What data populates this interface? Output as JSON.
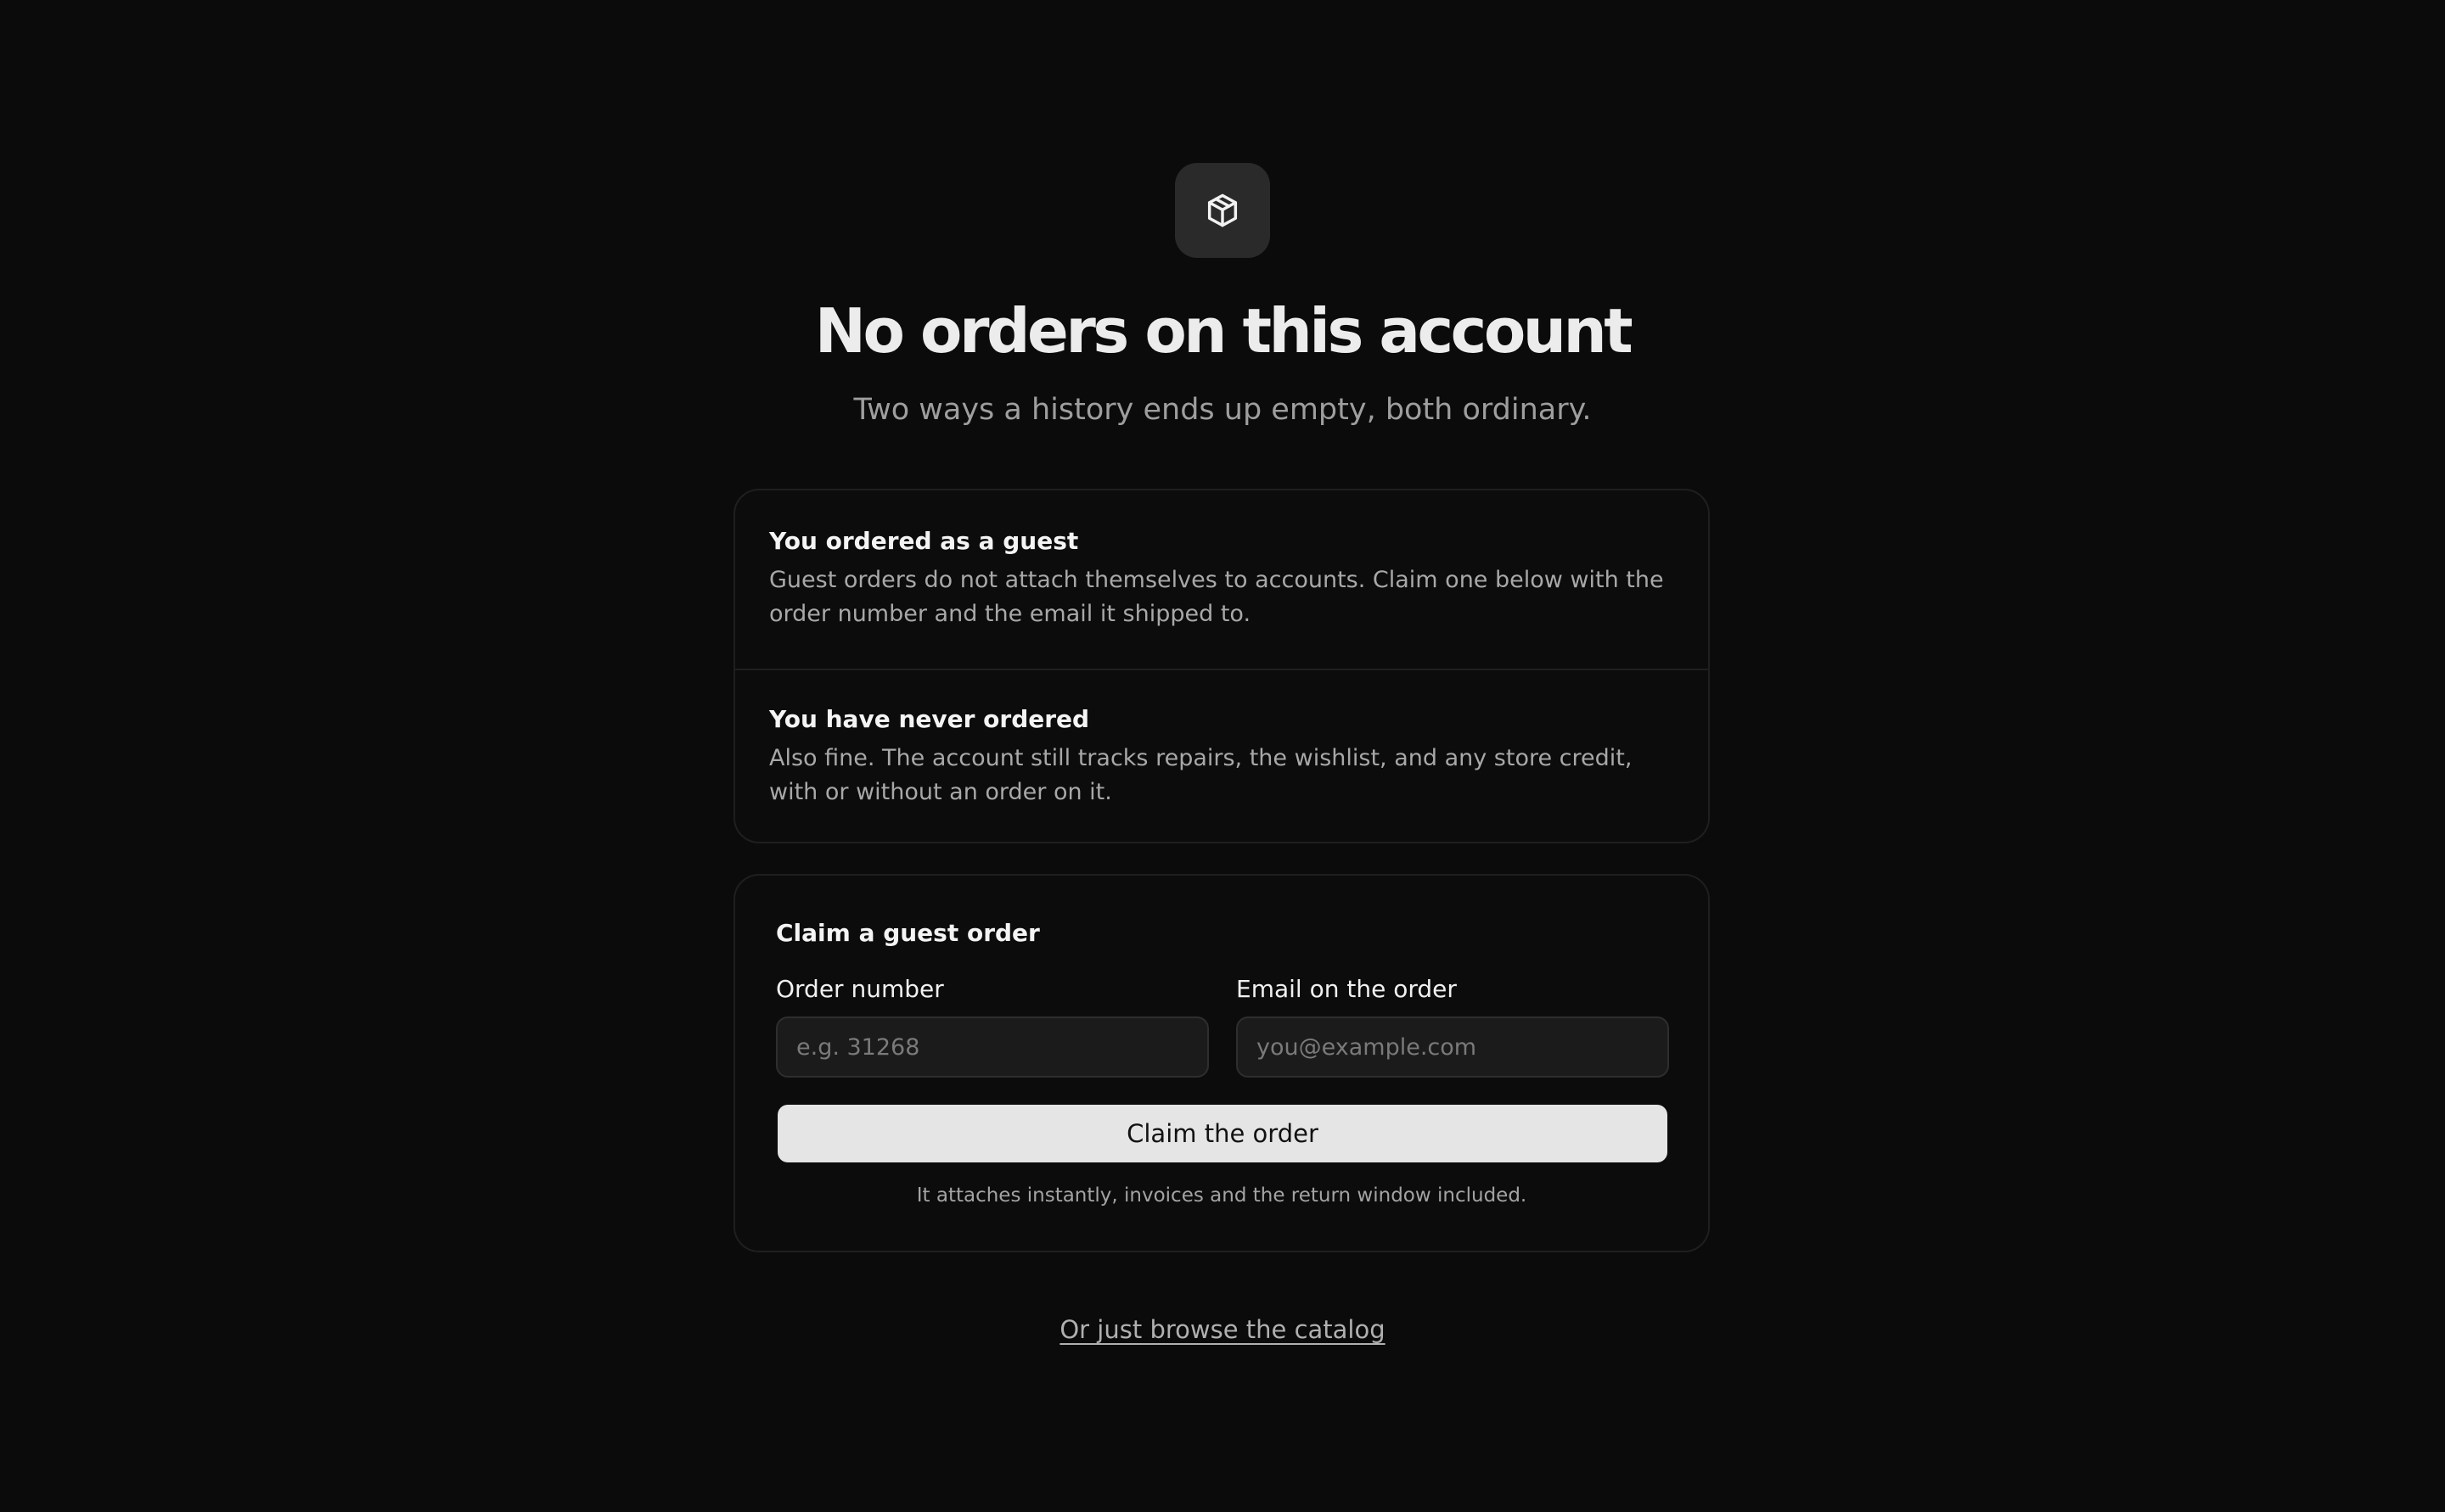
{
  "header": {
    "icon": "package-box-icon",
    "title": "No orders on this account",
    "subtitle": "Two ways a history ends up empty, both ordinary."
  },
  "reasons": [
    {
      "title": "You ordered as a guest",
      "body": "Guest orders do not attach themselves to accounts. Claim one below with the order number and the email it shipped to."
    },
    {
      "title": "You have never ordered",
      "body": "Also fine. The account still tracks repairs, the wishlist, and any store credit, with or without an order on it."
    }
  ],
  "claim_form": {
    "title": "Claim a guest order",
    "order_number": {
      "label": "Order number",
      "placeholder": "e.g. 31268",
      "value": ""
    },
    "email": {
      "label": "Email on the order",
      "placeholder": "you@example.com",
      "value": ""
    },
    "submit_label": "Claim the order",
    "note": "It attaches instantly, invoices and the return window included."
  },
  "footer": {
    "browse_link": "Or just browse the catalog"
  },
  "colors": {
    "background": "#0b0b0b",
    "button": "#e5e5e5",
    "icon_tile": "#2a2a2a"
  }
}
